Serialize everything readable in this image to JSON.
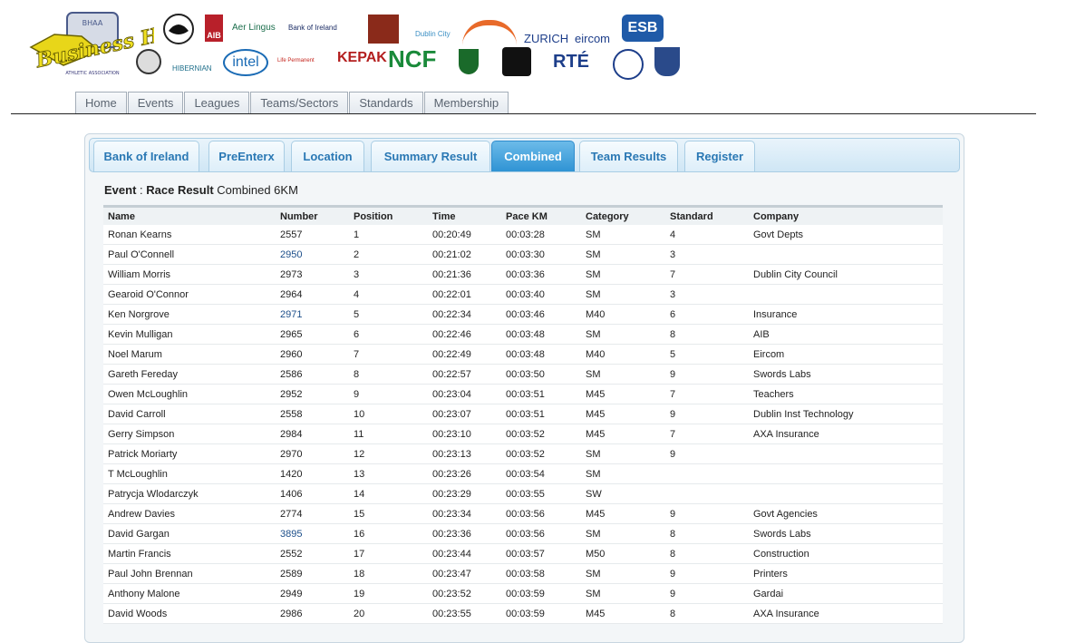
{
  "header": {
    "logo_text": "Business Houses",
    "logo_sub": "ATHLETIC ASSOCIATION",
    "sponsors_row1": [
      "AIB",
      "Aer Lingus",
      "Bank of Ireland",
      "Dublin City",
      "ZURICH",
      "eircom",
      "ESB"
    ],
    "sponsors_row2": [
      "HIBERNIAN",
      "intel",
      "Life Permanent",
      "KEPAK",
      "NCF",
      "RTÉ"
    ]
  },
  "nav": {
    "items": [
      "Home",
      "Events",
      "Leagues",
      "Teams/Sectors",
      "Standards",
      "Membership"
    ]
  },
  "tabs": [
    {
      "label": "Bank of Ireland",
      "active": false
    },
    {
      "label": "PreEnterx",
      "active": false
    },
    {
      "label": "Location",
      "active": false
    },
    {
      "label": "Summary Result",
      "active": false
    },
    {
      "label": "Combined",
      "active": true
    },
    {
      "label": "Team Results",
      "active": false
    },
    {
      "label": "Register",
      "active": false
    }
  ],
  "event": {
    "label": "Event",
    "race_label": "Race Result",
    "name": "Combined 6KM"
  },
  "table": {
    "columns": [
      "Name",
      "Number",
      "Position",
      "Time",
      "Pace KM",
      "Category",
      "Standard",
      "Company"
    ],
    "rows": [
      [
        "Ronan Kearns",
        "2557",
        "1",
        "00:20:49",
        "00:03:28",
        "SM",
        "4",
        "Govt Depts"
      ],
      [
        "Paul O'Connell",
        "2950",
        "2",
        "00:21:02",
        "00:03:30",
        "SM",
        "3",
        ""
      ],
      [
        "William Morris",
        "2973",
        "3",
        "00:21:36",
        "00:03:36",
        "SM",
        "7",
        "Dublin City Council"
      ],
      [
        "Gearoid O'Connor",
        "2964",
        "4",
        "00:22:01",
        "00:03:40",
        "SM",
        "3",
        ""
      ],
      [
        "Ken Norgrove",
        "2971",
        "5",
        "00:22:34",
        "00:03:46",
        "M40",
        "6",
        "Insurance"
      ],
      [
        "Kevin Mulligan",
        "2965",
        "6",
        "00:22:46",
        "00:03:48",
        "SM",
        "8",
        "AIB"
      ],
      [
        "Noel Marum",
        "2960",
        "7",
        "00:22:49",
        "00:03:48",
        "M40",
        "5",
        "Eircom"
      ],
      [
        "Gareth Fereday",
        "2586",
        "8",
        "00:22:57",
        "00:03:50",
        "SM",
        "9",
        "Swords Labs"
      ],
      [
        "Owen McLoughlin",
        "2952",
        "9",
        "00:23:04",
        "00:03:51",
        "M45",
        "7",
        "Teachers"
      ],
      [
        "David Carroll",
        "2558",
        "10",
        "00:23:07",
        "00:03:51",
        "M45",
        "9",
        "Dublin Inst Technology"
      ],
      [
        "Gerry Simpson",
        "2984",
        "11",
        "00:23:10",
        "00:03:52",
        "M45",
        "7",
        "AXA Insurance"
      ],
      [
        "Patrick Moriarty",
        "2970",
        "12",
        "00:23:13",
        "00:03:52",
        "SM",
        "9",
        ""
      ],
      [
        "T McLoughlin",
        "1420",
        "13",
        "00:23:26",
        "00:03:54",
        "SM",
        "",
        ""
      ],
      [
        "Patrycja Wlodarczyk",
        "1406",
        "14",
        "00:23:29",
        "00:03:55",
        "SW",
        "",
        ""
      ],
      [
        "Andrew Davies",
        "2774",
        "15",
        "00:23:34",
        "00:03:56",
        "M45",
        "9",
        "Govt Agencies"
      ],
      [
        "David Gargan",
        "3895",
        "16",
        "00:23:36",
        "00:03:56",
        "SM",
        "8",
        "Swords Labs"
      ],
      [
        "Martin Francis",
        "2552",
        "17",
        "00:23:44",
        "00:03:57",
        "M50",
        "8",
        "Construction"
      ],
      [
        "Paul John Brennan",
        "2589",
        "18",
        "00:23:47",
        "00:03:58",
        "SM",
        "9",
        "Printers"
      ],
      [
        "Anthony Malone",
        "2949",
        "19",
        "00:23:52",
        "00:03:59",
        "SM",
        "9",
        "Gardai"
      ],
      [
        "David Woods",
        "2986",
        "20",
        "00:23:55",
        "00:03:59",
        "M45",
        "8",
        "AXA Insurance"
      ]
    ],
    "linked_numbers": [
      "2950",
      "2971",
      "3895"
    ]
  }
}
